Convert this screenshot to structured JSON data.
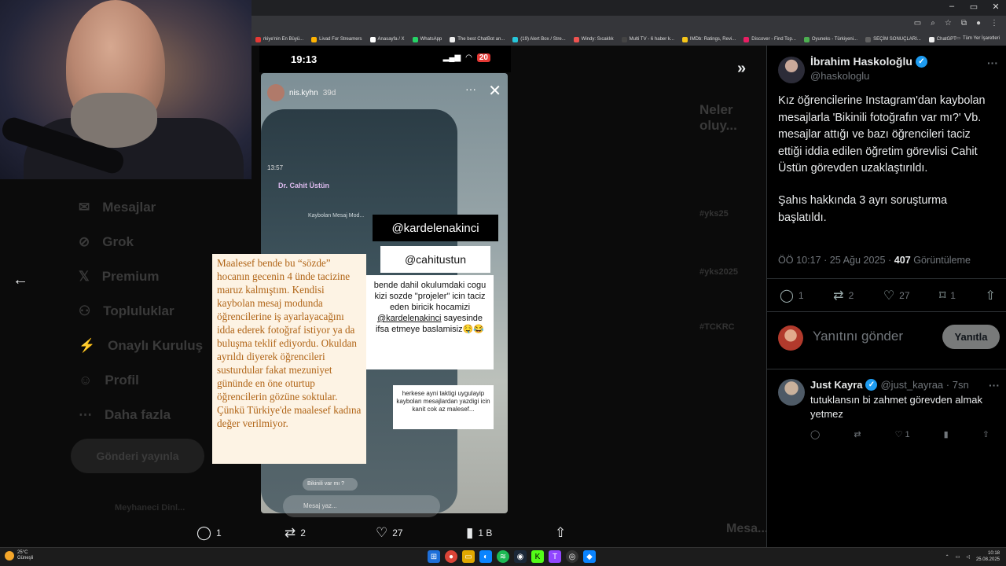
{
  "bookmarks": [
    {
      "label": "rkiye'nin En Büyü...",
      "color": "#e53935"
    },
    {
      "label": "Livad For Streamers",
      "color": "#ffb300"
    },
    {
      "label": "Anasayfa / X",
      "color": "#ffffff"
    },
    {
      "label": "WhatsApp",
      "color": "#25d366"
    },
    {
      "label": "The best ChatBot an...",
      "color": "#eeeeee"
    },
    {
      "label": "(19) Alert Box / Stre...",
      "color": "#26c6da"
    },
    {
      "label": "Windy: Sıcaklık",
      "color": "#ef5350"
    },
    {
      "label": "Multi TV - 6 haber k...",
      "color": "#444444"
    },
    {
      "label": "IMDb: Ratings, Revi...",
      "color": "#f5c518"
    },
    {
      "label": "Discover - Find Top...",
      "color": "#e91e63"
    },
    {
      "label": "Oyuneks - Türkiyeni...",
      "color": "#4caf50"
    },
    {
      "label": "SEÇİM SONUÇLARI...",
      "color": "#616161"
    },
    {
      "label": "ChatGPT",
      "color": "#eeeeee"
    }
  ],
  "bookmarks_all": "Tüm Yer İşaretleri",
  "background_nav": [
    "Mesajlar",
    "Grok",
    "Premium",
    "Topluluklar",
    "Onaylı Kuruluş",
    "Profil",
    "Daha fazla"
  ],
  "background_post_button": "Gönderi yayınla",
  "background_account": "Meyhaneci Dinl...",
  "background_right": {
    "title": "Neler oluy...",
    "trends": [
      "#yks25",
      "#yks2025",
      "#TCKRC"
    ],
    "sidebar_label": "Mesa..."
  },
  "story": {
    "phone_time": "19:13",
    "battery": "20",
    "username": "nis.kyhn",
    "age": "39d",
    "inner_time": "13:57",
    "inner_contact": "Dr. Cahit Üstün",
    "inner_title": "Kaybolan Mesaj Mod...",
    "tag1": "@kardelenakinci",
    "tag2": "@cahitustun",
    "note1_parts": [
      "bende dahil okulumdaki cogu kizi sozde \"projeler\" icin taciz eden biricik hocamizi ",
      "@kardelenakinci",
      " sayesinde ifsa etmeye baslamisiz",
      "🤤😂"
    ],
    "note2": "herkese ayni taktigi uygulayip kaybolan mesajlardan yazdigi icin kanit cok az malesef...",
    "excerpt": "Maalesef bende bu “sözde” hocanın gecenin 4 ünde tacizine maruz kalmıştım. Kendisi kaybolan mesaj modunda öğrencilerine iş ayarlayacağını idda ederek fotoğraf istiyor ya da buluşma teklif ediyordu. Okuldan ayrıldı diyerek öğrencileri susturdular fakat mezuniyet gününde en öne oturtup öğrencilerin gözüne soktular. Çünkü Türkiye'de maalesef kadına değer verilmiyor.",
    "inner_chip": "Bikinili var mı ?",
    "inner_input": "Mesaj yaz..."
  },
  "media_actions": {
    "replies": "1",
    "reposts": "2",
    "likes": "27",
    "views": "1 B"
  },
  "tweet": {
    "author": "İbrahim Haskoloğlu",
    "handle": "@haskologlu",
    "paragraph1": "Kız öğrencilerine Instagram'dan kaybolan mesajlarla 'Bikinili fotoğrafın var mı?' Vb. mesajlar attığı ve bazı öğrencileri taciz ettiği iddia edilen öğretim görevlisi Cahit Üstün görevden uzaklaştırıldı.",
    "paragraph2": "Şahıs hakkında 3 ayrı soruşturma başlatıldı.",
    "time": "ÖÖ 10:17 · 25 Ağu 2025 · ",
    "views_count": "407",
    "views_label": " Görüntüleme",
    "replies": "1",
    "reposts": "2",
    "likes": "27",
    "bookmarks": "1"
  },
  "reply_box": {
    "placeholder": "Yanıtını gönder",
    "button": "Yanıtla"
  },
  "reply": {
    "name": "Just Kayra",
    "handle": "@just_kayraa · 7sn",
    "text": "tutuklansın bi zahmet görevden almak yetmez",
    "likes": "1"
  },
  "taskbar": {
    "temp": "25°C",
    "weather": "Güneşli",
    "time": "10:18",
    "date": "25.08.2025"
  }
}
